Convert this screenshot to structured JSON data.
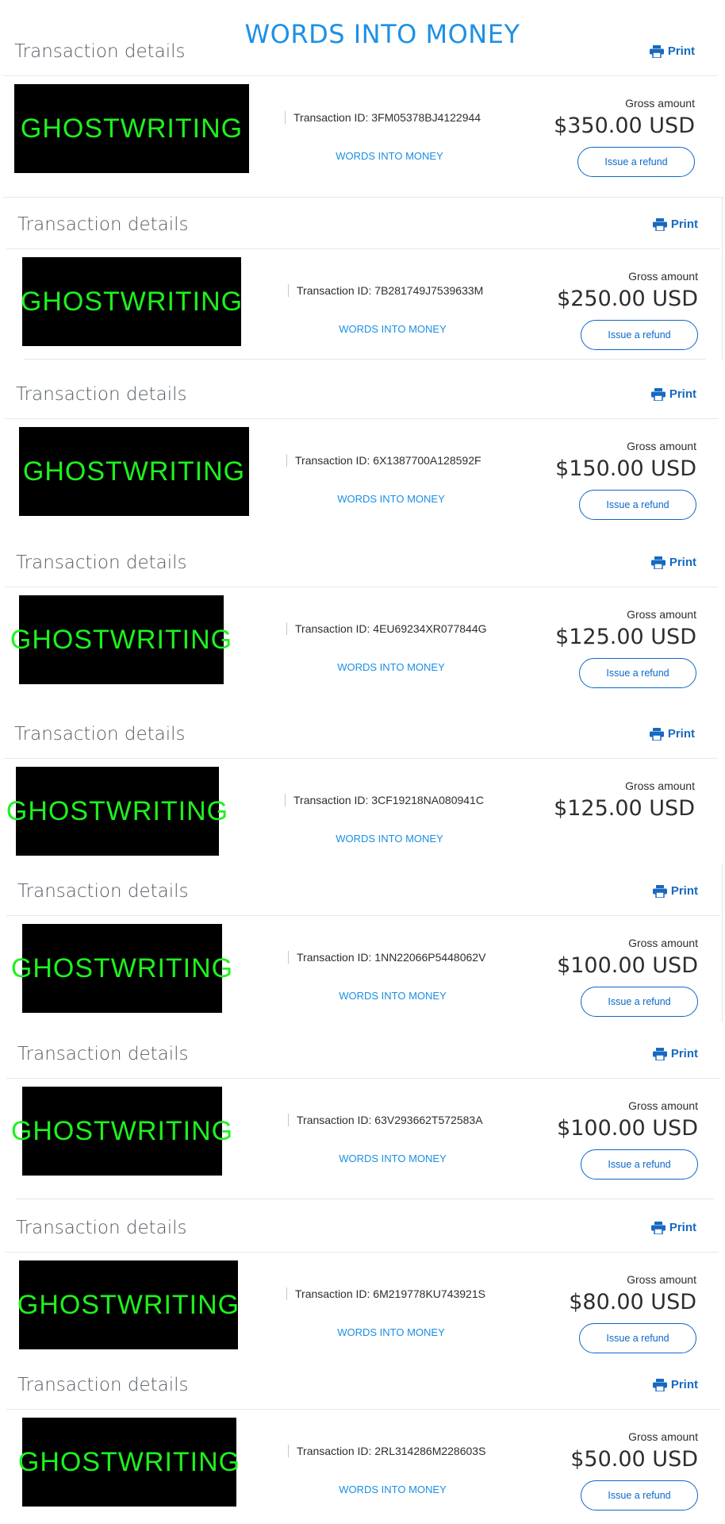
{
  "banner": "WORDS INTO MONEY",
  "transactions": [
    {
      "title": "Transaction details",
      "print_label": "Print",
      "thumbnail_text": "GHOSTWRITING",
      "transaction_id_label": "Transaction ID: 3FM05378BJ4122944",
      "merchant": "WORDS INTO MONEY",
      "gross_label": "Gross amount",
      "amount": "$350.00 USD",
      "refund_label": "Issue a refund"
    },
    {
      "title": "Transaction details",
      "print_label": "Print",
      "thumbnail_text": "GHOSTWRITING",
      "transaction_id_label": "Transaction ID: 7B281749J7539633M",
      "merchant": "WORDS INTO MONEY",
      "gross_label": "Gross amount",
      "amount": "$250.00 USD",
      "refund_label": "Issue a refund"
    },
    {
      "title": "Transaction details",
      "print_label": "Print",
      "thumbnail_text": "GHOSTWRITING",
      "transaction_id_label": "Transaction ID: 6X1387700A128592F",
      "merchant": "WORDS INTO MONEY",
      "gross_label": "Gross amount",
      "amount": "$150.00 USD",
      "refund_label": "Issue a refund"
    },
    {
      "title": "Transaction details",
      "print_label": "Print",
      "thumbnail_text": "GHOSTWRITING",
      "transaction_id_label": "Transaction ID: 4EU69234XR077844G",
      "merchant": "WORDS INTO MONEY",
      "gross_label": "Gross amount",
      "amount": "$125.00 USD",
      "refund_label": "Issue a refund"
    },
    {
      "title": "Transaction details",
      "print_label": "Print",
      "thumbnail_text": "GHOSTWRITING",
      "transaction_id_label": "Transaction ID: 3CF19218NA080941C",
      "merchant": "WORDS INTO MONEY",
      "gross_label": "Gross amount",
      "amount": "$125.00 USD",
      "refund_label": null
    },
    {
      "title": "Transaction details",
      "print_label": "Print",
      "thumbnail_text": "GHOSTWRITING",
      "transaction_id_label": "Transaction ID: 1NN22066P5448062V",
      "merchant": "WORDS INTO MONEY",
      "gross_label": "Gross amount",
      "amount": "$100.00 USD",
      "refund_label": "Issue a refund"
    },
    {
      "title": "Transaction details",
      "print_label": "Print",
      "thumbnail_text": "GHOSTWRITING",
      "transaction_id_label": "Transaction ID: 63V293662T572583A",
      "merchant": "WORDS INTO MONEY",
      "gross_label": "Gross amount",
      "amount": "$100.00 USD",
      "refund_label": "Issue a refund"
    },
    {
      "title": "Transaction details",
      "print_label": "Print",
      "thumbnail_text": "GHOSTWRITING",
      "transaction_id_label": "Transaction ID: 6M219778KU743921S",
      "merchant": "WORDS INTO MONEY",
      "gross_label": "Gross amount",
      "amount": "$80.00 USD",
      "refund_label": "Issue a refund"
    },
    {
      "title": "Transaction details",
      "print_label": "Print",
      "thumbnail_text": "GHOSTWRITING",
      "transaction_id_label": "Transaction ID: 2RL314286M228603S",
      "merchant": "WORDS INTO MONEY",
      "gross_label": "Gross amount",
      "amount": "$50.00 USD",
      "refund_label": "Issue a refund"
    }
  ],
  "colors": {
    "banner": "#1e90e6",
    "link": "#1769c0",
    "thumbnail_background": "#000000",
    "thumbnail_text": "#1ef21e"
  },
  "icons": {
    "print": "printer-icon"
  }
}
